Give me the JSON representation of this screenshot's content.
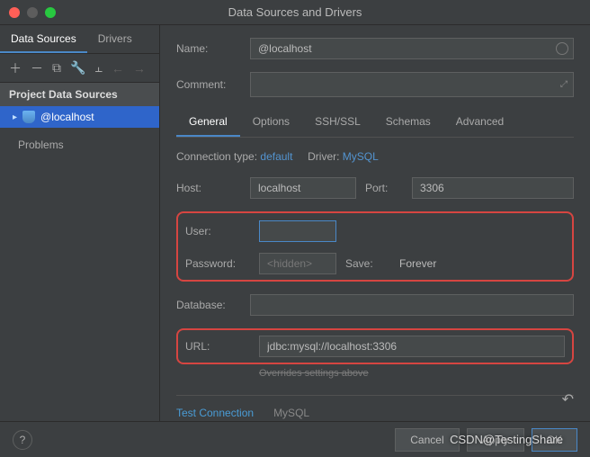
{
  "window": {
    "title": "Data Sources and Drivers"
  },
  "sidebar": {
    "tabs": [
      {
        "label": "Data Sources",
        "active": true
      },
      {
        "label": "Drivers",
        "active": false
      }
    ],
    "section_header": "Project Data Sources",
    "selected_item": "@localhost",
    "problems_label": "Problems"
  },
  "form": {
    "name_label": "Name:",
    "name_value": "@localhost",
    "comment_label": "Comment:",
    "tabs": [
      {
        "label": "General",
        "active": true
      },
      {
        "label": "Options"
      },
      {
        "label": "SSH/SSL"
      },
      {
        "label": "Schemas"
      },
      {
        "label": "Advanced"
      }
    ],
    "conn_type_label": "Connection type:",
    "conn_type_value": "default",
    "driver_label": "Driver:",
    "driver_value": "MySQL",
    "host_label": "Host:",
    "host_value": "localhost",
    "port_label": "Port:",
    "port_value": "3306",
    "user_label": "User:",
    "user_value": "",
    "password_label": "Password:",
    "password_placeholder": "<hidden>",
    "save_label": "Save:",
    "save_value": "Forever",
    "database_label": "Database:",
    "database_value": "",
    "url_label": "URL:",
    "url_value": "jdbc:mysql://localhost:3306",
    "override_text": "Overrides settings above",
    "test_connection": "Test Connection",
    "driver_info": "MySQL"
  },
  "footer": {
    "cancel": "Cancel",
    "apply": "Apply",
    "ok": "OK"
  },
  "watermark": "CSDN@TestingShare"
}
